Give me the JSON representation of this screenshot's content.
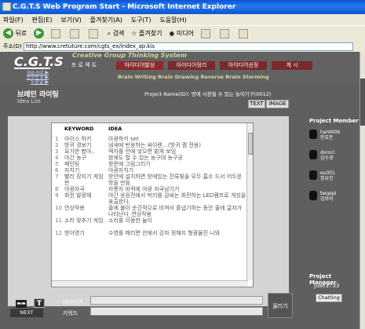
{
  "window": {
    "title": "C.G.T.S Web Program Start - Microsoft Internet Explorer"
  },
  "menu": [
    "파일(F)",
    "편집(E)",
    "보기(V)",
    "즐겨찾기(A)",
    "도구(T)",
    "도움말(H)"
  ],
  "toolbar": {
    "back": "뒤로",
    "search": "검색",
    "favorites": "즐겨찾기",
    "media": "미디어"
  },
  "address": {
    "label": "주소(D)",
    "url": "http://www.cretuture.com/cgts_ex/index_ap.kis"
  },
  "site": {
    "logo": "C.G.T.S",
    "slogan": "Creative Group Thinking System",
    "links": [
      "log-out ▶",
      "정보변경 ▶",
      "도움말 ▶"
    ],
    "tabs": [
      "프 로 젝 트",
      "아이디어발상",
      "아이디어정리",
      "아이디어선정",
      "게 시"
    ],
    "subnav": "Brain Writing  Brain Drawing  Reverse Brain Storming"
  },
  "main": {
    "title": "브레인 라이팅",
    "subtitle": "Idea List",
    "project_name": "Project Name(ID): 병에 사용될 수 있는 놀이기구(0012)",
    "text_button": "TEXT",
    "image_button": "IMAGE"
  },
  "table": {
    "col_keyword": "KEYWORD",
    "col_idea": "IDEA",
    "rows": [
      {
        "no": "1",
        "keyword": "아이스 하키",
        "idea": "아광하키 set"
      },
      {
        "no": "2",
        "keyword": "방귀 경보기",
        "idea": "냄새에 반응하는 싸이렌…(방귀 캠 전용)"
      },
      {
        "no": "3",
        "keyword": "요가한 봤아..",
        "idea": "액자를 안에 넣으면 밝게 보임"
      },
      {
        "no": "4",
        "keyword": "야간 농구",
        "idea": "밤에도 할 수 있는 농구대 농구공"
      },
      {
        "no": "5",
        "keyword": "페인팅",
        "idea": "창문에 그림그리기"
      },
      {
        "no": "6",
        "keyword": "자치기",
        "idea": "야광자치기"
      },
      {
        "no": "7",
        "keyword": "빨리 장지기 게임판",
        "idea": "방안에 설치하면 방에있는 잔류빛을 모두 흡수 드서 어두운 방을 만듬"
      },
      {
        "no": "8",
        "keyword": "야광자국",
        "idea": "자롱자 바퀴에 야광 자국남기기"
      },
      {
        "no": "9",
        "keyword": "회전 발광체",
        "idea": "야간 응원전에서 머리를 감싸는 회전하는 LED램프로 개성을 표출한다."
      },
      {
        "no": "10",
        "keyword": "연상작용",
        "idea": "줄에 불이 순간적으로 비쳐서 흘냅기하는 동안 줄에 글자가 나타난다_연상작용"
      },
      {
        "no": "11",
        "keyword": "소리 맞추기 게임",
        "idea": "소리를 이용한 놀이"
      },
      {
        "no": "12",
        "keyword": "방이명기",
        "idea": "수영를 때리면 안에서 강자 정해지 형광물진 나와"
      }
    ]
  },
  "form": {
    "idea_label": "아이디어",
    "keyword_label": "키워드",
    "submit_label": "올리기",
    "next_label": "NEXT",
    "tool_icon": "▬▬",
    "text_icon": "T"
  },
  "sidebar": {
    "members_title": "Project Member",
    "members": [
      {
        "line1": "hard409",
        "line2": "한효돈"
      },
      {
        "line1": "doroci",
        "line2": "김수경"
      },
      {
        "line1": "eu001",
        "line2": "정유진"
      },
      {
        "line1": "begepi",
        "line2": "김보라"
      }
    ],
    "manager_title": "Project Manager",
    "manager_name": "Juke1733",
    "chat_label": "Chatting"
  }
}
